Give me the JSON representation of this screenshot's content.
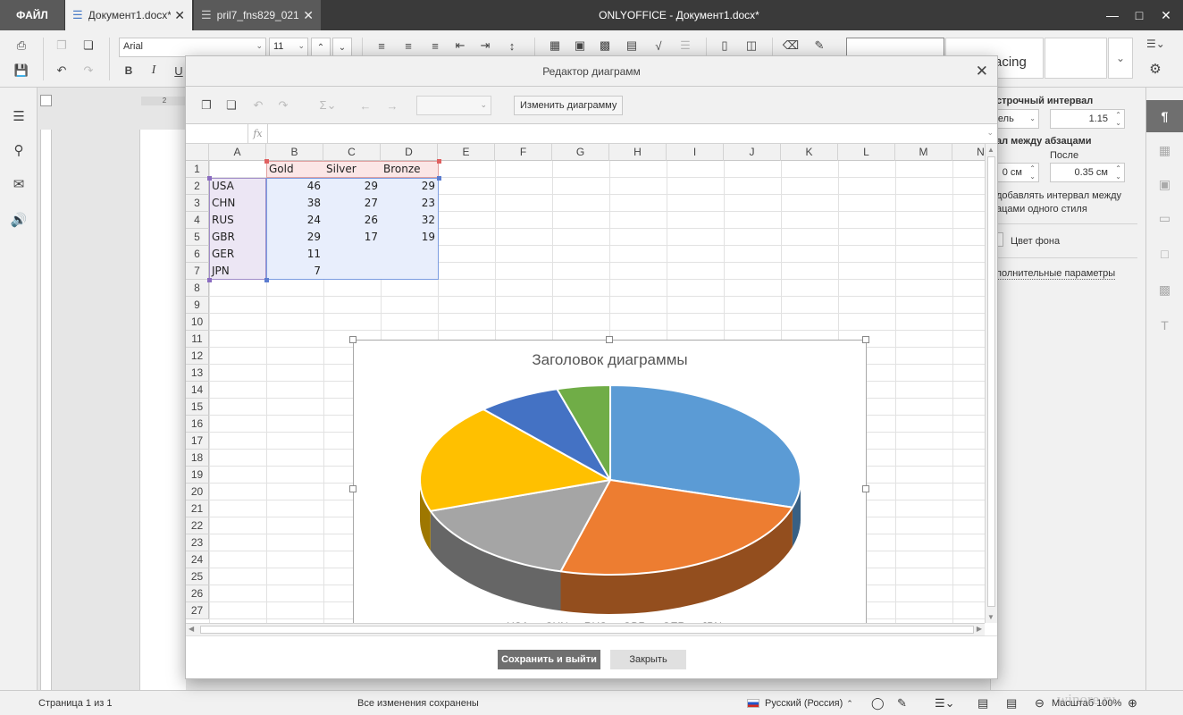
{
  "titlebar": {
    "file_tab": "ФАЙЛ",
    "tabs": [
      {
        "label": "Документ1.docx*"
      },
      {
        "label": "pril7_fns829_021..."
      }
    ],
    "app_title": "ONLYOFFICE - Документ1.docx*"
  },
  "toolbar": {
    "font_name": "Arial",
    "font_size": "11",
    "bold": "B",
    "italic": "I",
    "underline": "U",
    "style_preview": "acing"
  },
  "ruler": {
    "h_mark": "2"
  },
  "right_panel": {
    "line_spacing_title": "строчный интервал",
    "line_spacing_mode": "тель",
    "line_spacing_value": "1.15",
    "para_spacing_title": "ал между абзацами",
    "after_label": "После",
    "before_value": "0 см",
    "after_value": "0.35 см",
    "dont_add_line1": "добавлять интервал между",
    "dont_add_line2": "ацами одного стиля",
    "bg_color_label": "Цвет фона",
    "advanced_label": "полнительные параметры"
  },
  "statusbar": {
    "page_info": "Страница 1 из 1",
    "save_status": "Все изменения сохранены",
    "language": "Русский (Россия)",
    "zoom": "Масштаб 100%"
  },
  "watermark": "winore.ru",
  "modal": {
    "title": "Редактор диаграмм",
    "change_chart_button": "Изменить диаграмму",
    "fx": "fx",
    "save_exit_button": "Сохранить и выйти",
    "close_button": "Закрыть",
    "columns": [
      "A",
      "B",
      "C",
      "D",
      "E",
      "F",
      "G",
      "H",
      "I",
      "J",
      "K",
      "L",
      "M",
      "N"
    ],
    "rows": [
      "1",
      "2",
      "3",
      "4",
      "5",
      "6",
      "7",
      "8",
      "9",
      "10",
      "11",
      "12",
      "13",
      "14",
      "15",
      "16",
      "17",
      "18",
      "19",
      "20",
      "21",
      "22",
      "23",
      "24",
      "25",
      "26",
      "27"
    ],
    "sheet": {
      "headers": [
        "Gold",
        "Silver",
        "Bronze"
      ],
      "data": [
        {
          "country": "USA",
          "gold": "46",
          "silver": "29",
          "bronze": "29"
        },
        {
          "country": "CHN",
          "gold": "38",
          "silver": "27",
          "bronze": "23"
        },
        {
          "country": "RUS",
          "gold": "24",
          "silver": "26",
          "bronze": "32"
        },
        {
          "country": "GBR",
          "gold": "29",
          "silver": "17",
          "bronze": "19"
        },
        {
          "country": "GER",
          "gold": "11",
          "silver": "",
          "bronze": ""
        },
        {
          "country": "JPN",
          "gold": "7",
          "silver": "",
          "bronze": ""
        }
      ]
    }
  },
  "chart_data": {
    "type": "pie",
    "style": "3d",
    "title": "Заголовок диаграммы",
    "categories": [
      "USA",
      "CHN",
      "RUS",
      "GBR",
      "GER",
      "JPN"
    ],
    "series": [
      {
        "name": "Gold",
        "values": [
          46,
          38,
          24,
          29,
          11,
          7
        ]
      }
    ],
    "colors": [
      "#5b9bd5",
      "#ed7d31",
      "#a5a5a5",
      "#ffc000",
      "#4472c4",
      "#70ad47"
    ],
    "legend_position": "bottom"
  },
  "colors": {
    "titlebar_bg": "#3a3a3a",
    "accent_button": "#6f6f6f"
  }
}
